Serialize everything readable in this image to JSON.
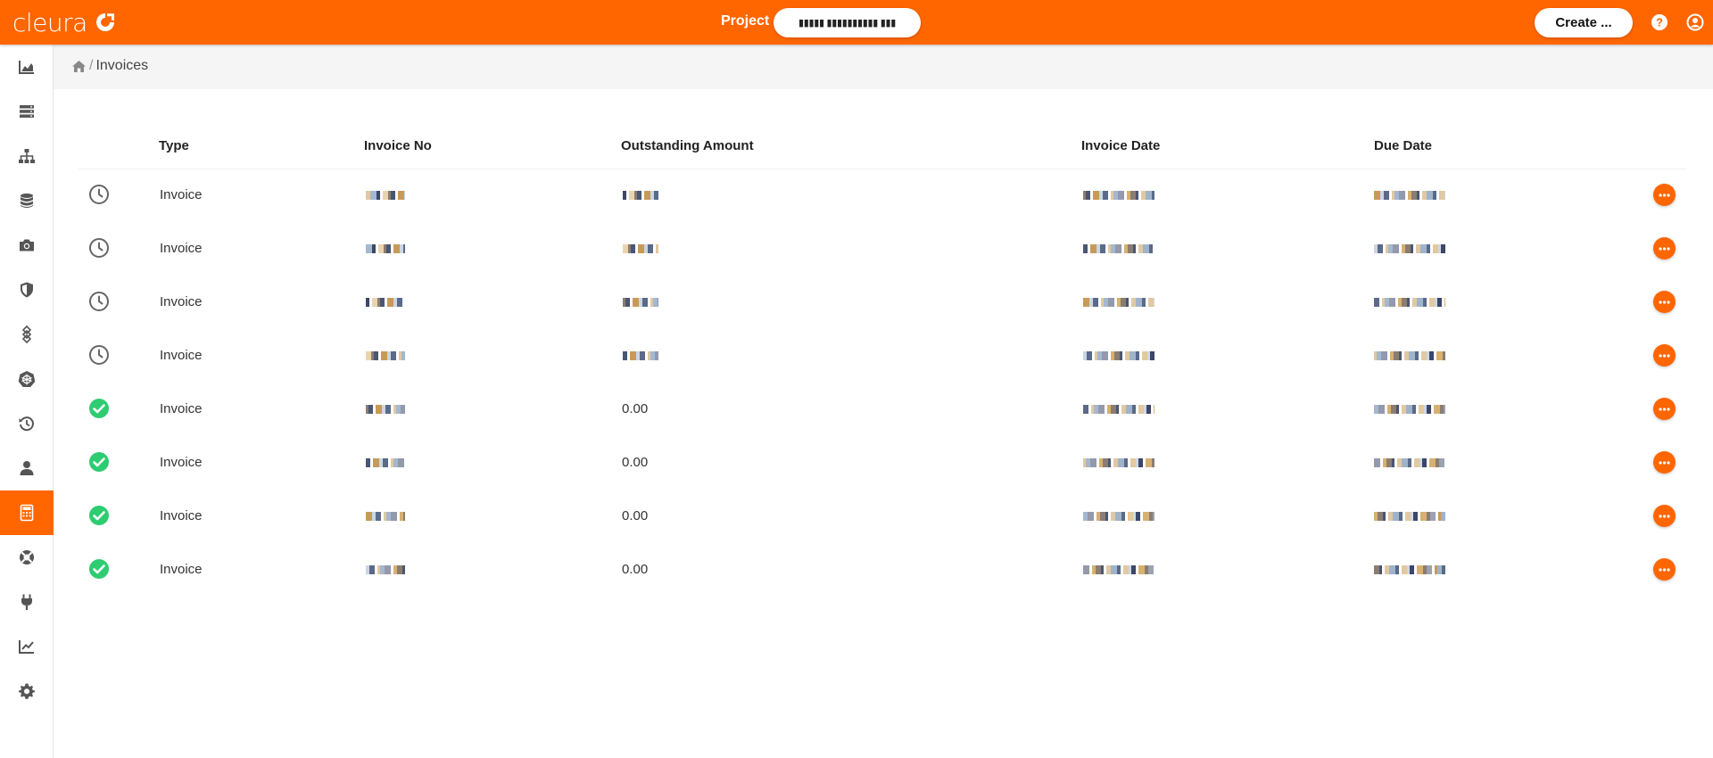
{
  "app": {
    "brand": "cleura",
    "project_label": "Project",
    "project_value": "▮▮▮▮▮ ▮▮▮▮▮▮▮▮▮▮ ▮▮▮",
    "create_label": "Create ...",
    "accent": "#ff6600"
  },
  "sidebar": {
    "items": [
      {
        "icon": "area-chart-icon"
      },
      {
        "icon": "servers-icon"
      },
      {
        "icon": "network-icon"
      },
      {
        "icon": "database-icon"
      },
      {
        "icon": "camera-icon"
      },
      {
        "icon": "shield-icon"
      },
      {
        "icon": "layers-icon"
      },
      {
        "icon": "kubernetes-icon"
      },
      {
        "icon": "history-icon"
      },
      {
        "icon": "user-icon"
      },
      {
        "icon": "calculator-icon",
        "active": true
      },
      {
        "icon": "lifebuoy-icon"
      },
      {
        "icon": "plug-icon"
      },
      {
        "icon": "line-chart-icon"
      },
      {
        "icon": "gear-icon"
      }
    ]
  },
  "breadcrumb": {
    "home_icon": "home-icon",
    "separator": "/",
    "current": "Invoices"
  },
  "table": {
    "columns": [
      "Type",
      "Invoice No",
      "Outstanding Amount",
      "Invoice Date",
      "Due Date"
    ],
    "rows": [
      {
        "status": "pending",
        "type": "Invoice",
        "amount": ""
      },
      {
        "status": "pending",
        "type": "Invoice",
        "amount": ""
      },
      {
        "status": "pending",
        "type": "Invoice",
        "amount": ""
      },
      {
        "status": "pending",
        "type": "Invoice",
        "amount": ""
      },
      {
        "status": "paid",
        "type": "Invoice",
        "amount": "0.00"
      },
      {
        "status": "paid",
        "type": "Invoice",
        "amount": "0.00"
      },
      {
        "status": "paid",
        "type": "Invoice",
        "amount": "0.00"
      },
      {
        "status": "paid",
        "type": "Invoice",
        "amount": "0.00"
      }
    ]
  },
  "colors": {
    "pending": "#666666",
    "paid": "#2ecc71"
  }
}
